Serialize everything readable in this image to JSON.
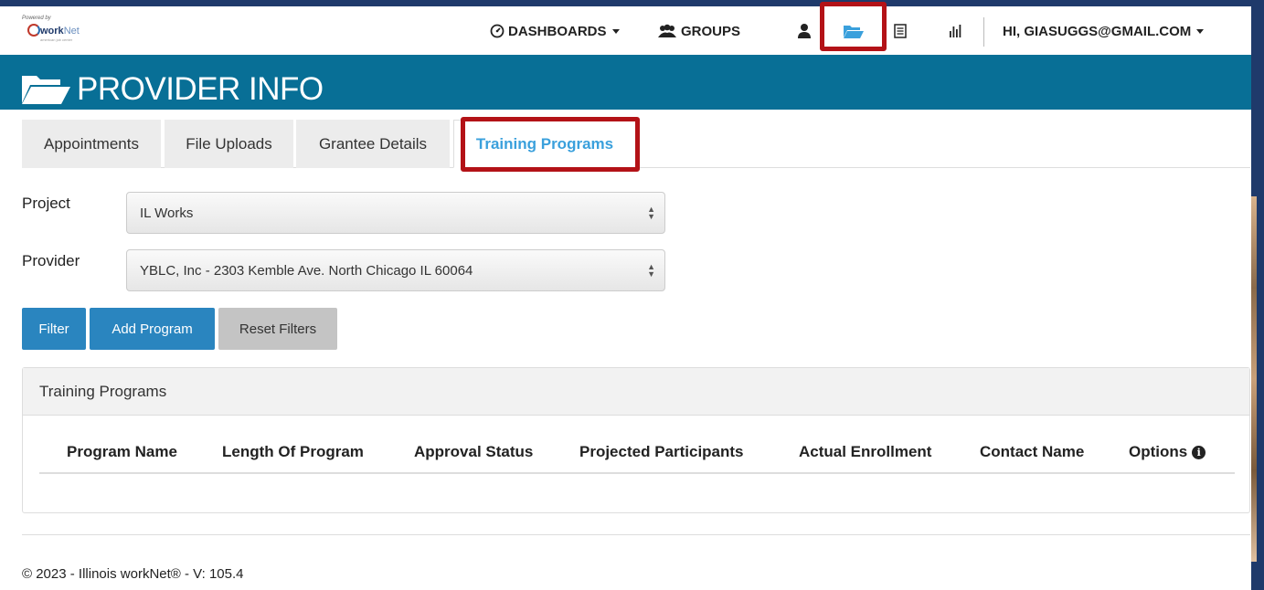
{
  "logo": {
    "powered": "Powered by",
    "brand_main": "work",
    "brand_suffix": "Net",
    "tagline": "american job center"
  },
  "topnav": {
    "dashboards": "DASHBOARDS",
    "groups": "GROUPS",
    "greeting": "HI, GIASUGGS@GMAIL.COM"
  },
  "page": {
    "title": "PROVIDER INFO"
  },
  "tabs": [
    {
      "label": "Appointments"
    },
    {
      "label": "File Uploads"
    },
    {
      "label": "Grantee Details"
    },
    {
      "label": "Training Programs"
    }
  ],
  "form": {
    "project_label": "Project",
    "project_value": "IL Works",
    "provider_label": "Provider",
    "provider_value": "YBLC, Inc - 2303 Kemble Ave. North Chicago IL 60064"
  },
  "buttons": {
    "filter": "Filter",
    "add_program": "Add Program",
    "reset_filters": "Reset Filters"
  },
  "panel": {
    "title": "Training Programs",
    "columns": [
      "Program Name",
      "Length Of Program",
      "Approval Status",
      "Projected Participants",
      "Actual Enrollment",
      "Contact Name",
      "Options"
    ],
    "rows": []
  },
  "footer": {
    "text": "© 2023 - Illinois workNet® - V: 105.4"
  },
  "colors": {
    "header_band": "#086f96",
    "accent_blue": "#3aa0dc",
    "button_blue": "#2a85bf",
    "highlight_red": "#b31217"
  },
  "icons": [
    "dashboard-gauge-icon",
    "groups-icon",
    "user-icon",
    "folder-open-icon",
    "list-icon",
    "stats-bars-icon",
    "info-circle-icon"
  ]
}
